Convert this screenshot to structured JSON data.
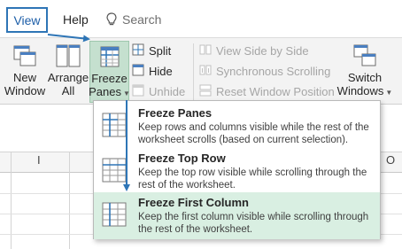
{
  "tabs": {
    "view": "View",
    "help": "Help"
  },
  "tell_me": {
    "label": "Search",
    "icon": "lightbulb-icon"
  },
  "ribbon": {
    "new_window": {
      "line1": "New",
      "line2": "Window",
      "icon": "new-window-icon"
    },
    "arrange_all": {
      "line1": "Arrange",
      "line2": "All",
      "icon": "arrange-all-icon"
    },
    "freeze_panes": {
      "line1": "Freeze",
      "line2": "Panes",
      "icon": "freeze-panes-icon"
    },
    "split": {
      "label": "Split",
      "icon": "split-icon"
    },
    "hide": {
      "label": "Hide",
      "icon": "hide-icon"
    },
    "unhide": {
      "label": "Unhide",
      "icon": "unhide-icon",
      "enabled": false
    },
    "view_side_by_side": {
      "label": "View Side by Side",
      "icon": "view-side-by-side-icon",
      "enabled": false
    },
    "synchronous_scrolling": {
      "label": "Synchronous Scrolling",
      "icon": "synchronous-scrolling-icon",
      "enabled": false
    },
    "reset_window_position": {
      "label": "Reset Window Position",
      "icon": "reset-window-position-icon",
      "enabled": false
    },
    "switch_windows": {
      "line1": "Switch",
      "line2": "Windows",
      "icon": "switch-windows-icon"
    }
  },
  "sheet": {
    "col_i": "I",
    "col_o": "O"
  },
  "freeze_menu": {
    "items": [
      {
        "title": "Freeze Panes",
        "description": "Keep rows and columns visible while the rest of the worksheet scrolls (based on current selection).",
        "icon": "freeze-panes-icon"
      },
      {
        "title": "Freeze Top Row",
        "description": "Keep the top row visible while scrolling through the rest of the worksheet.",
        "icon": "freeze-top-row-icon"
      },
      {
        "title": "Freeze First Column",
        "description": "Keep the first column visible while scrolling through the rest of the worksheet.",
        "icon": "freeze-first-column-icon",
        "selected": true
      }
    ]
  },
  "colors": {
    "accent_blue": "#2e75b6",
    "selected_green": "#d9efe2",
    "freeze_button_green": "#c5e0cf"
  }
}
